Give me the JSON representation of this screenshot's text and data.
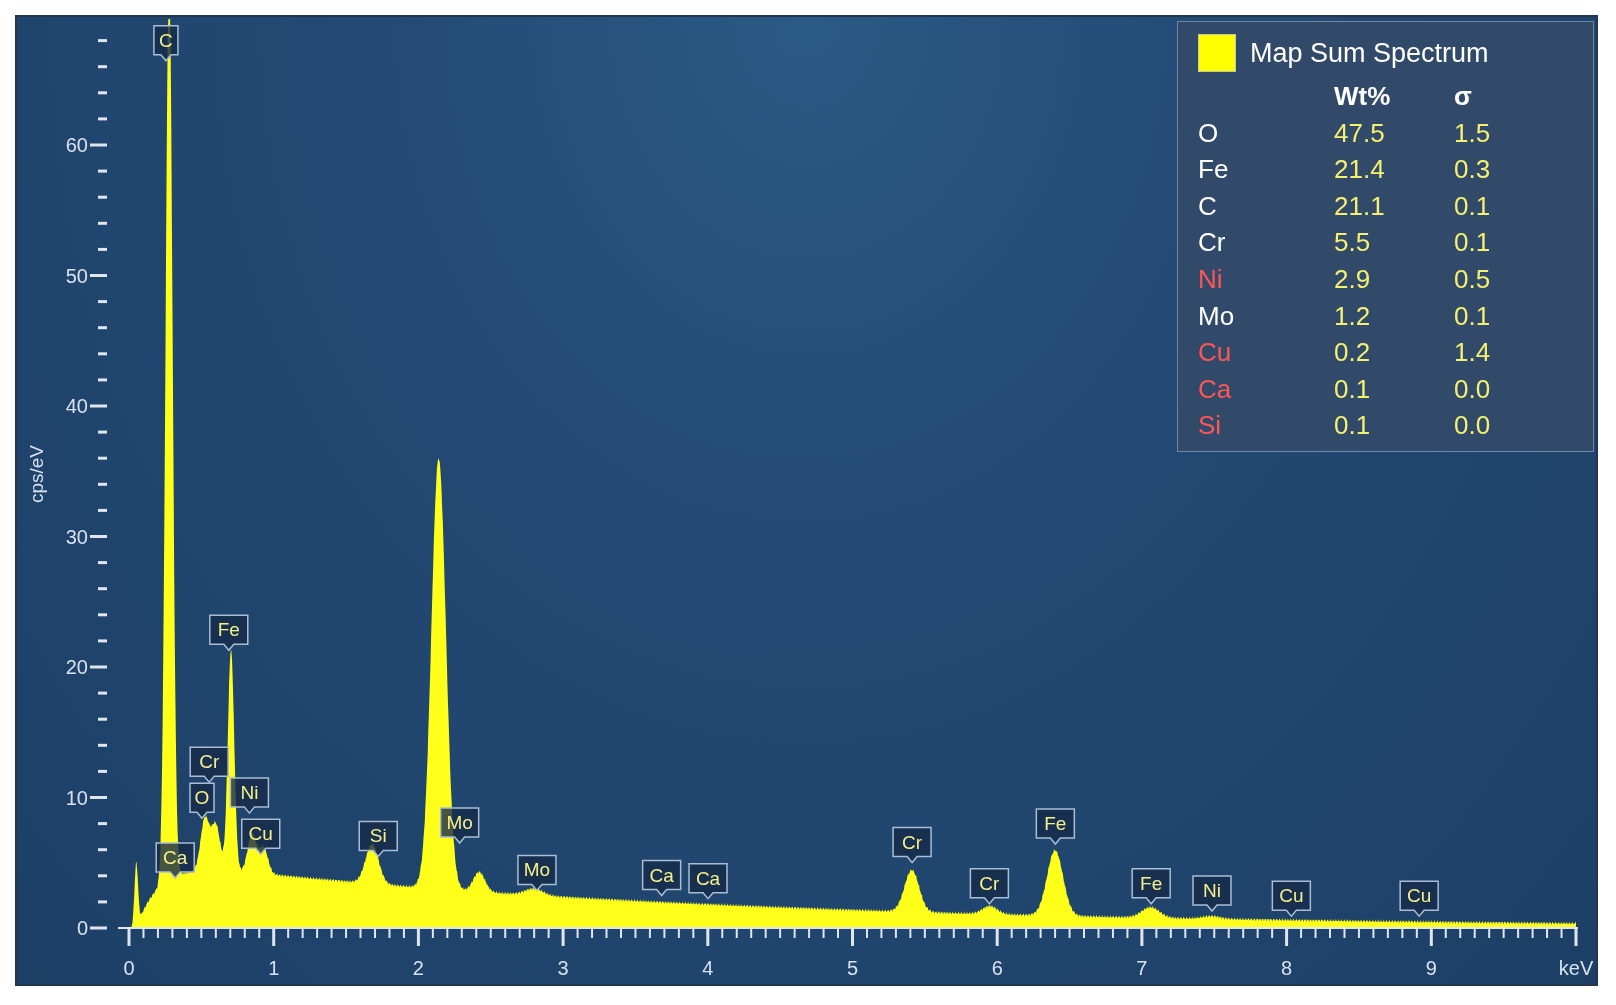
{
  "chart": {
    "ylabel": "cps/eV",
    "xunit": "keV",
    "y_ticks": [
      "60",
      "50",
      "40",
      "30",
      "20",
      "10",
      "0"
    ],
    "x_ticks": [
      "0",
      "1",
      "2",
      "3",
      "4",
      "5",
      "6",
      "7",
      "8",
      "9"
    ],
    "peak_labels": [
      "C",
      "Ca",
      "O",
      "Cr",
      "Fe",
      "Ni",
      "Cu",
      "Si",
      "Mo",
      "Mo",
      "Ca",
      "Ca",
      "Cr",
      "Cr",
      "Fe",
      "Fe",
      "Ni",
      "Cu",
      "Cu"
    ]
  },
  "legend": {
    "title": "Map Sum Spectrum",
    "columns": [
      "Wt%",
      "σ"
    ],
    "rows": [
      {
        "element": "O",
        "color": "#ffffff",
        "wt": "47.5",
        "sigma": "1.5"
      },
      {
        "element": "Fe",
        "color": "#ffffff",
        "wt": "21.4",
        "sigma": "0.3"
      },
      {
        "element": "C",
        "color": "#ffffff",
        "wt": "21.1",
        "sigma": "0.1"
      },
      {
        "element": "Cr",
        "color": "#ffffff",
        "wt": "5.5",
        "sigma": "0.1"
      },
      {
        "element": "Ni",
        "color": "#ff5555",
        "wt": "2.9",
        "sigma": "0.5"
      },
      {
        "element": "Mo",
        "color": "#ffffff",
        "wt": "1.2",
        "sigma": "0.1"
      },
      {
        "element": "Cu",
        "color": "#ff5555",
        "wt": "0.2",
        "sigma": "1.4"
      },
      {
        "element": "Ca",
        "color": "#ff5555",
        "wt": "0.1",
        "sigma": "0.0"
      },
      {
        "element": "Si",
        "color": "#ff5555",
        "wt": "0.1",
        "sigma": "0.0"
      }
    ]
  }
}
